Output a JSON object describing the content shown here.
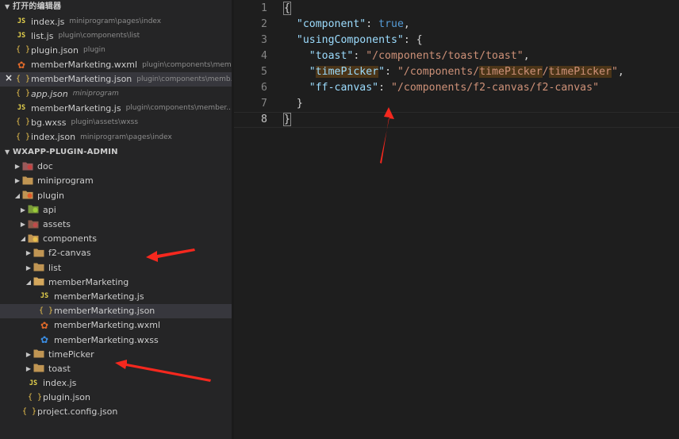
{
  "sidebar": {
    "open_editors_title": "打开的编辑器",
    "open_editors": [
      {
        "icon": "js",
        "name": "index.js",
        "path": "miniprogram\\pages\\index",
        "italic": false,
        "active": false,
        "close": false
      },
      {
        "icon": "js",
        "name": "list.js",
        "path": "plugin\\components\\list",
        "italic": false,
        "active": false,
        "close": false
      },
      {
        "icon": "json",
        "name": "plugin.json",
        "path": "plugin",
        "italic": false,
        "active": false,
        "close": false
      },
      {
        "icon": "wxml",
        "name": "memberMarketing.wxml",
        "path": "plugin\\components\\mem...",
        "italic": false,
        "active": false,
        "close": false
      },
      {
        "icon": "json",
        "name": "memberMarketing.json",
        "path": "plugin\\components\\memb...",
        "italic": false,
        "active": true,
        "close": true
      },
      {
        "icon": "json",
        "name": "app.json",
        "path": "miniprogram",
        "italic": true,
        "active": false,
        "close": false
      },
      {
        "icon": "js",
        "name": "memberMarketing.js",
        "path": "plugin\\components\\member...",
        "italic": false,
        "active": false,
        "close": false
      },
      {
        "icon": "wxs",
        "name": "bg.wxss",
        "path": "plugin\\assets\\wxss",
        "italic": false,
        "active": false,
        "close": false
      },
      {
        "icon": "json",
        "name": "index.json",
        "path": "miniprogram\\pages\\index",
        "italic": false,
        "active": false,
        "close": false
      }
    ],
    "project_title": "WXAPP-PLUGIN-ADMIN",
    "tree": [
      {
        "depth": 0,
        "twisty": "closed",
        "icon": "folder-doc",
        "name": "doc"
      },
      {
        "depth": 0,
        "twisty": "closed",
        "icon": "folder",
        "name": "miniprogram"
      },
      {
        "depth": 0,
        "twisty": "open",
        "icon": "folder-plugin",
        "name": "plugin"
      },
      {
        "depth": 1,
        "twisty": "closed",
        "icon": "folder-api",
        "name": "api"
      },
      {
        "depth": 1,
        "twisty": "closed",
        "icon": "folder-assets",
        "name": "assets"
      },
      {
        "depth": 1,
        "twisty": "open",
        "icon": "folder-components",
        "name": "components"
      },
      {
        "depth": 2,
        "twisty": "closed",
        "icon": "folder",
        "name": "f2-canvas"
      },
      {
        "depth": 2,
        "twisty": "closed",
        "icon": "folder",
        "name": "list"
      },
      {
        "depth": 2,
        "twisty": "open",
        "icon": "folder-open",
        "name": "memberMarketing"
      },
      {
        "depth": 3,
        "twisty": "none",
        "icon": "js",
        "name": "memberMarketing.js"
      },
      {
        "depth": 3,
        "twisty": "none",
        "icon": "json",
        "name": "memberMarketing.json",
        "selected": true
      },
      {
        "depth": 3,
        "twisty": "none",
        "icon": "wxml",
        "name": "memberMarketing.wxml"
      },
      {
        "depth": 3,
        "twisty": "none",
        "icon": "wxss",
        "name": "memberMarketing.wxss"
      },
      {
        "depth": 2,
        "twisty": "closed",
        "icon": "folder",
        "name": "timePicker"
      },
      {
        "depth": 2,
        "twisty": "closed",
        "icon": "folder",
        "name": "toast"
      },
      {
        "depth": 1,
        "twisty": "none",
        "icon": "js",
        "name": "index.js"
      },
      {
        "depth": 1,
        "twisty": "none",
        "icon": "json",
        "name": "plugin.json"
      },
      {
        "depth": 0,
        "twisty": "none",
        "icon": "json",
        "name": "project.config.json"
      }
    ]
  },
  "editor": {
    "lines": [
      {
        "n": "1",
        "tokens": [
          {
            "t": "{",
            "c": "punc",
            "match": true
          }
        ]
      },
      {
        "n": "2",
        "tokens": [
          {
            "t": "  ",
            "c": "punc"
          },
          {
            "t": "\"component\"",
            "c": "key"
          },
          {
            "t": ": ",
            "c": "punc"
          },
          {
            "t": "true",
            "c": "bool"
          },
          {
            "t": ",",
            "c": "punc"
          }
        ]
      },
      {
        "n": "3",
        "tokens": [
          {
            "t": "  ",
            "c": "punc"
          },
          {
            "t": "\"usingComponents\"",
            "c": "key"
          },
          {
            "t": ": {",
            "c": "punc"
          }
        ]
      },
      {
        "n": "4",
        "tokens": [
          {
            "t": "    ",
            "c": "punc"
          },
          {
            "t": "\"toast\"",
            "c": "key"
          },
          {
            "t": ": ",
            "c": "punc"
          },
          {
            "t": "\"/components/toast/toast\"",
            "c": "str"
          },
          {
            "t": ",",
            "c": "punc"
          }
        ]
      },
      {
        "n": "5",
        "tokens": [
          {
            "t": "    ",
            "c": "punc"
          },
          {
            "t": "\"",
            "c": "key"
          },
          {
            "t": "timePicker",
            "c": "key",
            "hl": true
          },
          {
            "t": "\"",
            "c": "key"
          },
          {
            "t": ": ",
            "c": "punc"
          },
          {
            "t": "\"/components/",
            "c": "str"
          },
          {
            "t": "timePicker",
            "c": "str",
            "hl": true
          },
          {
            "t": "/",
            "c": "str"
          },
          {
            "t": "timePicker",
            "c": "str",
            "hl": true
          },
          {
            "t": "\"",
            "c": "str"
          },
          {
            "t": ",",
            "c": "punc"
          }
        ]
      },
      {
        "n": "6",
        "tokens": [
          {
            "t": "    ",
            "c": "punc"
          },
          {
            "t": "\"ff-canvas\"",
            "c": "key"
          },
          {
            "t": ": ",
            "c": "punc"
          },
          {
            "t": "\"/components/f2-canvas/f2-canvas\"",
            "c": "str"
          }
        ]
      },
      {
        "n": "7",
        "tokens": [
          {
            "t": "  }",
            "c": "punc"
          }
        ]
      },
      {
        "n": "8",
        "tokens": [
          {
            "t": "}",
            "c": "punc",
            "match": true
          }
        ],
        "current": true
      }
    ]
  },
  "colors": {
    "annotation_arrow": "#f5281e",
    "folder": "#c09553",
    "js": "#e8d44d"
  }
}
